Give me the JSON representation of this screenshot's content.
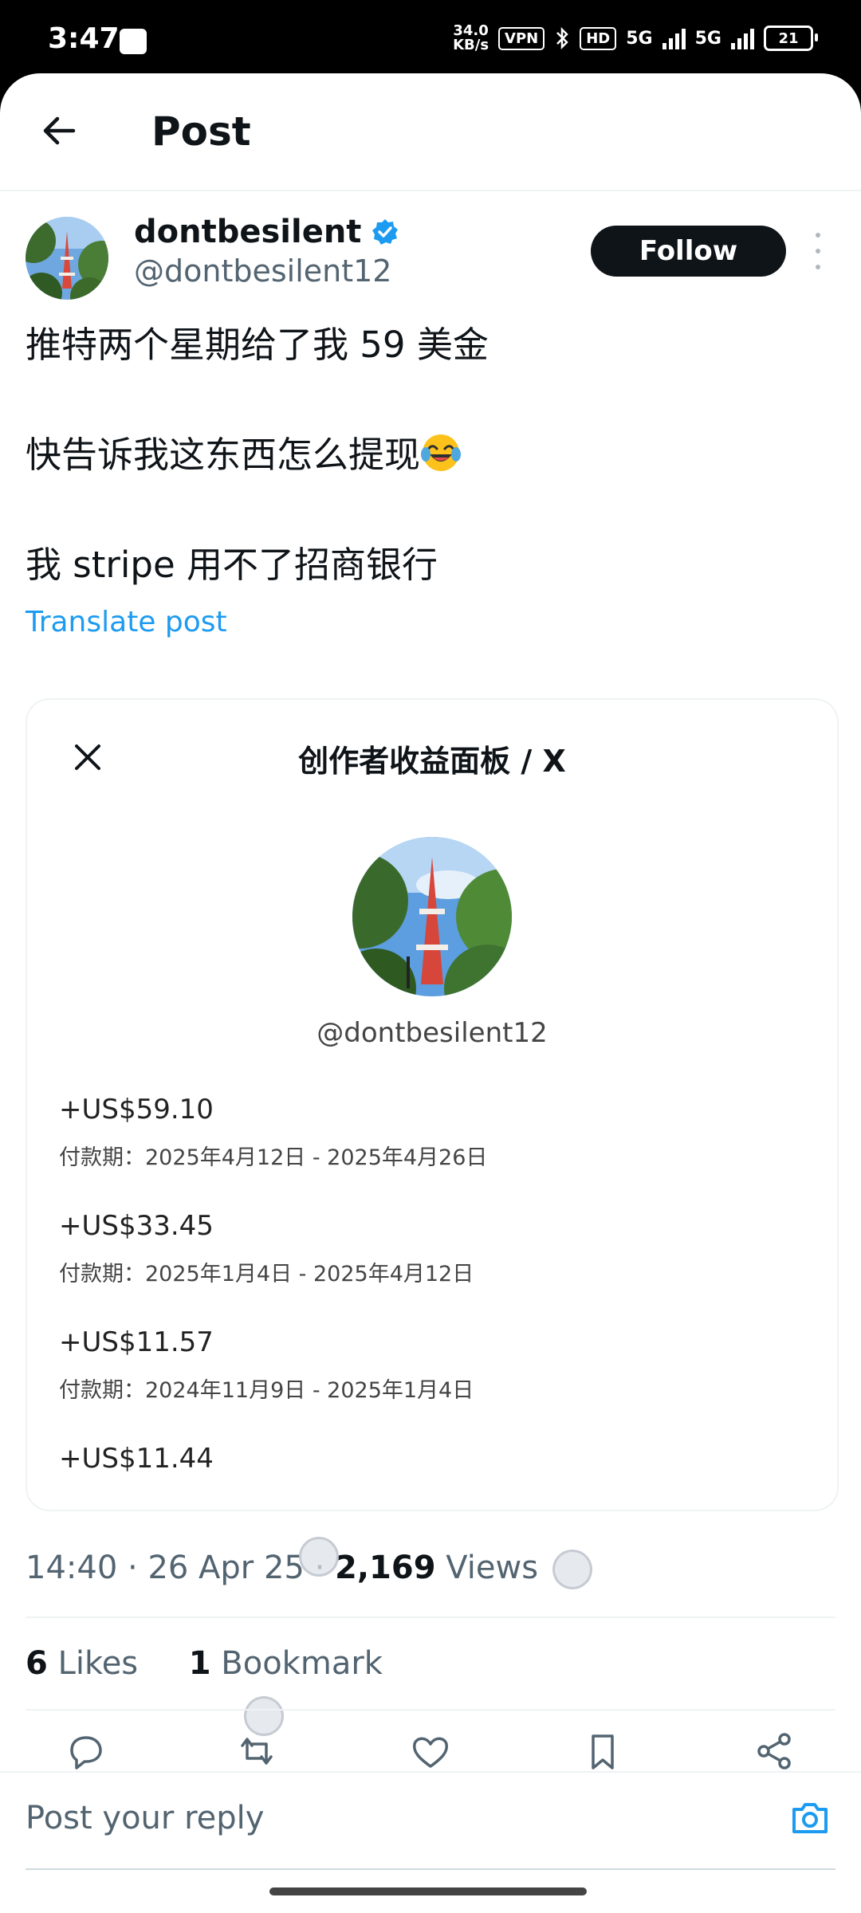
{
  "status_bar": {
    "time": "3:47",
    "net_speed_top": "34.0",
    "net_speed_bottom": "KB/s",
    "vpn": "VPN",
    "hd": "HD",
    "sig1": "5G",
    "sig2": "5G",
    "battery": "21"
  },
  "header": {
    "title": "Post"
  },
  "author": {
    "name": "dontbesilent",
    "handle": "@dontbesilent12",
    "follow_label": "Follow"
  },
  "post": {
    "line1": "推特两个星期给了我 59 美金",
    "line2": "快告诉我这东西怎么提现",
    "line2_emoji": "😂",
    "line3": "我 stripe 用不了招商银行",
    "translate_label": "Translate post"
  },
  "card": {
    "title": "创作者收益面板 / X",
    "handle": "@dontbesilent12",
    "earnings": [
      {
        "amount": "+US$59.10",
        "period": "付款期：2025年4月12日 - 2025年4月26日"
      },
      {
        "amount": "+US$33.45",
        "period": "付款期：2025年1月4日 - 2025年4月12日"
      },
      {
        "amount": "+US$11.57",
        "period": "付款期：2024年11月9日 - 2025年1月4日"
      },
      {
        "amount": "+US$11.44",
        "period": ""
      }
    ]
  },
  "meta": {
    "time": "14:40",
    "date": "26 Apr 25",
    "views_count": "2,169",
    "views_label": "Views"
  },
  "stats": {
    "likes_count": "6",
    "likes_label": "Likes",
    "bookmarks_count": "1",
    "bookmarks_label": "Bookmark"
  },
  "reply": {
    "placeholder": "Post your reply"
  },
  "icons": {
    "back": "arrow-left-icon",
    "verified": "verified-badge-icon",
    "more": "more-vertical-icon",
    "close": "close-icon",
    "reply": "reply-icon",
    "repost": "repost-icon",
    "like": "heart-icon",
    "bookmark": "bookmark-icon",
    "share": "share-icon",
    "camera": "camera-icon"
  },
  "colors": {
    "accent": "#1d9bf0",
    "text": "#0f1419",
    "muted": "#536471"
  }
}
